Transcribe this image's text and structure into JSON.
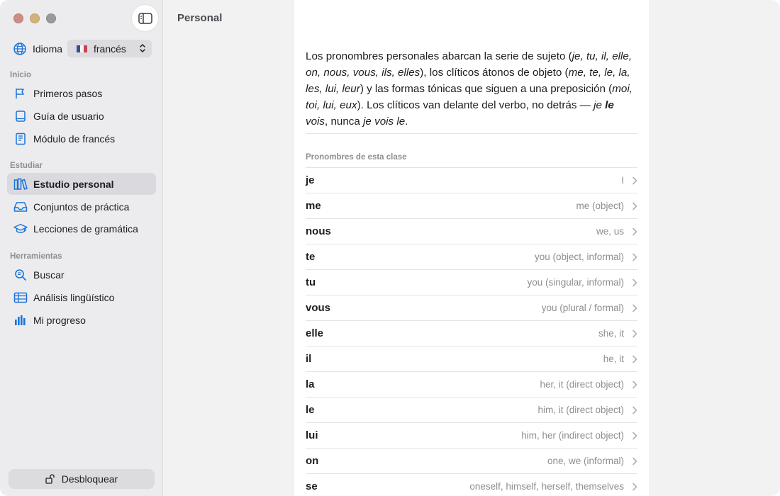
{
  "sidebar": {
    "language_label": "Idioma",
    "language_value": "francés",
    "sections": {
      "inicio": "Inicio",
      "estudiar": "Estudiar",
      "herramientas": "Herramientas"
    },
    "items": [
      {
        "label": "Primeros pasos",
        "icon": "flag-icon"
      },
      {
        "label": "Guía de usuario",
        "icon": "book-icon"
      },
      {
        "label": "Módulo de francés",
        "icon": "module-book-icon"
      },
      {
        "label": "Estudio personal",
        "icon": "books-icon",
        "active": true
      },
      {
        "label": "Conjuntos de práctica",
        "icon": "tray-icon"
      },
      {
        "label": "Lecciones de gramática",
        "icon": "graduation-cap-icon"
      },
      {
        "label": "Buscar",
        "icon": "search-icon"
      },
      {
        "label": "Análisis lingüístico",
        "icon": "table-icon"
      },
      {
        "label": "Mi progreso",
        "icon": "chart-icon"
      }
    ],
    "unlock_label": "Desbloquear"
  },
  "header": {
    "title": "Personal"
  },
  "main": {
    "list_title": "Pronombres de esta clase",
    "pronouns": [
      {
        "word": "je",
        "meaning": "I"
      },
      {
        "word": "me",
        "meaning": "me (object)"
      },
      {
        "word": "nous",
        "meaning": "we, us"
      },
      {
        "word": "te",
        "meaning": "you (object, informal)"
      },
      {
        "word": "tu",
        "meaning": "you (singular, informal)"
      },
      {
        "word": "vous",
        "meaning": "you (plural / formal)"
      },
      {
        "word": "elle",
        "meaning": "she, it"
      },
      {
        "word": "il",
        "meaning": "he, it"
      },
      {
        "word": "la",
        "meaning": "her, it (direct object)"
      },
      {
        "word": "le",
        "meaning": "him, it (direct object)"
      },
      {
        "word": "lui",
        "meaning": "him, her (indirect object)"
      },
      {
        "word": "on",
        "meaning": "one, we (informal)"
      },
      {
        "word": "se",
        "meaning": "oneself, himself, herself, themselves"
      }
    ]
  },
  "colors": {
    "accent": "#1a73d9",
    "sidebar_bg": "#ececee",
    "active_bg": "#dadade",
    "flag_blue": "#3a4e8c",
    "flag_red": "#c8414b"
  }
}
